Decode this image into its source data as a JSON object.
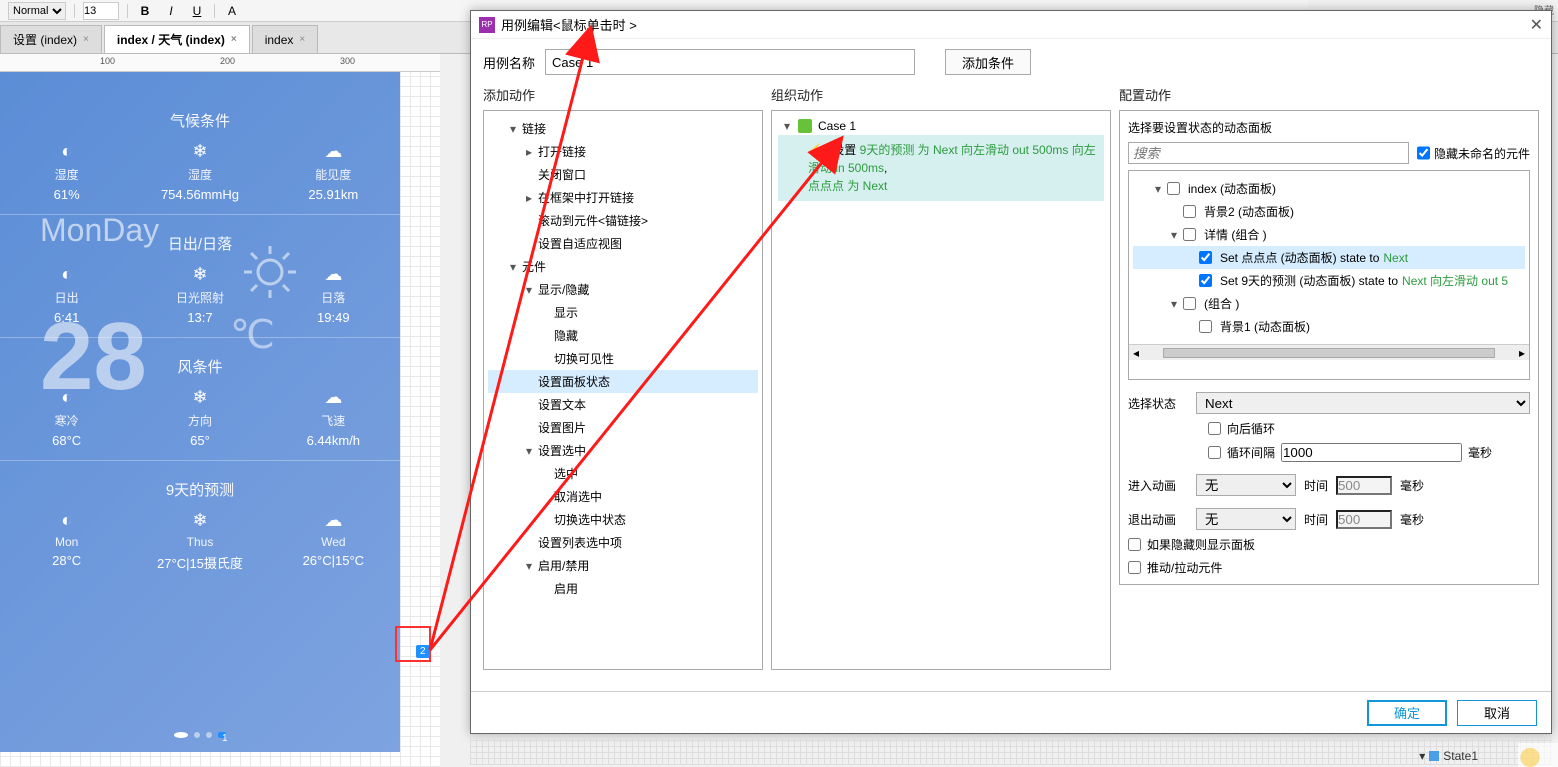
{
  "toolbar": {
    "style_label": "Normal",
    "font_size": "13"
  },
  "tabs": [
    {
      "label": "设置 (index)",
      "active": false
    },
    {
      "label": "index / 天气 (index)",
      "active": true
    },
    {
      "label": "index",
      "active": false
    }
  ],
  "ruler": [
    "100",
    "200",
    "300"
  ],
  "weather": {
    "big_day": "MonDay",
    "big_temp": "28",
    "big_unit": "℃",
    "sections": {
      "climate": {
        "title": "气候条件",
        "cells": [
          {
            "ico": "◐",
            "lab": "湿度",
            "val": "61%"
          },
          {
            "ico": "❄",
            "lab": "湿度",
            "val": "754.56mmHg"
          },
          {
            "ico": "☁",
            "lab": "能见度",
            "val": "25.91km"
          }
        ]
      },
      "sun": {
        "title": "日出/日落",
        "cells": [
          {
            "ico": "◐",
            "lab": "日出",
            "val": "6:41"
          },
          {
            "ico": "❄",
            "lab": "日光照射",
            "val": "13:7"
          },
          {
            "ico": "☁",
            "lab": "日落",
            "val": "19:49"
          }
        ]
      },
      "wind": {
        "title": "风条件",
        "cells": [
          {
            "ico": "◐",
            "lab": "寒冷",
            "val": "68°C"
          },
          {
            "ico": "❄",
            "lab": "方向",
            "val": "65°"
          },
          {
            "ico": "☁",
            "lab": "飞速",
            "val": "6.44km/h"
          }
        ]
      },
      "forecast": {
        "title": "9天的预测",
        "cells": [
          {
            "ico": "◐",
            "lab": "Mon",
            "val": "28°C"
          },
          {
            "ico": "❄",
            "lab": "Thus",
            "val": "27°C|15摄氏度"
          },
          {
            "ico": "☁",
            "lab": "Wed",
            "val": "26°C|15°C"
          }
        ]
      }
    },
    "forecast_badge": "2",
    "dots_badge": "1"
  },
  "dialog": {
    "title": "用例编辑<鼠标单击时 >",
    "case_name_label": "用例名称",
    "case_name_value": "Case 1",
    "add_condition": "添加条件",
    "close": "✕",
    "col_titles": {
      "add": "添加动作",
      "org": "组织动作",
      "cfg": "配置动作"
    },
    "actions_tree": [
      {
        "lvl": 0,
        "caret": "▾",
        "label": "链接"
      },
      {
        "lvl": 1,
        "caret": "▸",
        "label": "打开链接"
      },
      {
        "lvl": 1,
        "caret": "",
        "label": "关闭窗口"
      },
      {
        "lvl": 1,
        "caret": "▸",
        "label": "在框架中打开链接"
      },
      {
        "lvl": 1,
        "caret": "",
        "label": "滚动到元件<锚链接>"
      },
      {
        "lvl": 1,
        "caret": "",
        "label": "设置自适应视图"
      },
      {
        "lvl": 0,
        "caret": "▾",
        "label": "元件"
      },
      {
        "lvl": 1,
        "caret": "▾",
        "label": "显示/隐藏"
      },
      {
        "lvl": 2,
        "caret": "",
        "label": "显示"
      },
      {
        "lvl": 2,
        "caret": "",
        "label": "隐藏"
      },
      {
        "lvl": 2,
        "caret": "",
        "label": "切换可见性"
      },
      {
        "lvl": 1,
        "caret": "",
        "label": "设置面板状态",
        "selected": true
      },
      {
        "lvl": 1,
        "caret": "",
        "label": "设置文本"
      },
      {
        "lvl": 1,
        "caret": "",
        "label": "设置图片"
      },
      {
        "lvl": 1,
        "caret": "▾",
        "label": "设置选中"
      },
      {
        "lvl": 2,
        "caret": "",
        "label": "选中"
      },
      {
        "lvl": 2,
        "caret": "",
        "label": "取消选中"
      },
      {
        "lvl": 2,
        "caret": "",
        "label": "切换选中状态"
      },
      {
        "lvl": 1,
        "caret": "",
        "label": "设置列表选中项"
      },
      {
        "lvl": 1,
        "caret": "▾",
        "label": "启用/禁用"
      },
      {
        "lvl": 2,
        "caret": "",
        "label": "启用"
      }
    ],
    "case": {
      "name": "Case 1",
      "action_prefix": "设置 ",
      "action_green1": "9天的预测 为 Next 向左滑动 out 500ms 向左滑动 in 500ms",
      "action_sep": ", ",
      "action_green2": "点点点 为 Next"
    },
    "cfg": {
      "header": "选择要设置状态的动态面板",
      "search_placeholder": "搜索",
      "hide_unnamed": "隐藏未命名的元件",
      "widgets": [
        {
          "lvl": 0,
          "caret": "▾",
          "chk": false,
          "label": "index (动态面板)"
        },
        {
          "lvl": 1,
          "caret": "",
          "chk": false,
          "label": "背景2 (动态面板)"
        },
        {
          "lvl": 1,
          "caret": "▾",
          "chk": false,
          "label": "详情 (组合 )"
        },
        {
          "lvl": 2,
          "caret": "",
          "chk": true,
          "selected": true,
          "label_pre": "Set 点点点 (动态面板) state to ",
          "label_green": "Next"
        },
        {
          "lvl": 2,
          "caret": "",
          "chk": true,
          "label_pre": "Set 9天的预测 (动态面板) state to ",
          "label_green": "Next 向左滑动 out 5"
        },
        {
          "lvl": 1,
          "caret": "▾",
          "chk": false,
          "label": "(组合 )"
        },
        {
          "lvl": 2,
          "caret": "",
          "chk": false,
          "label": "背景1 (动态面板)"
        }
      ],
      "select_state_label": "选择状态",
      "select_state_value": "Next",
      "loop_back": "向后循环",
      "loop_interval_label": "循环间隔",
      "loop_interval_value": "1000",
      "ms": "毫秒",
      "anim_in_label": "进入动画",
      "anim_out_label": "退出动画",
      "anim_none": "无",
      "time_label": "时间",
      "time_value": "500",
      "show_if_hidden": "如果隐藏则显示面板",
      "push_pull": "推动/拉动元件"
    },
    "footer": {
      "ok": "确定",
      "cancel": "取消"
    }
  },
  "state_tag": "State1",
  "right_strip_hidden": "隐藏"
}
